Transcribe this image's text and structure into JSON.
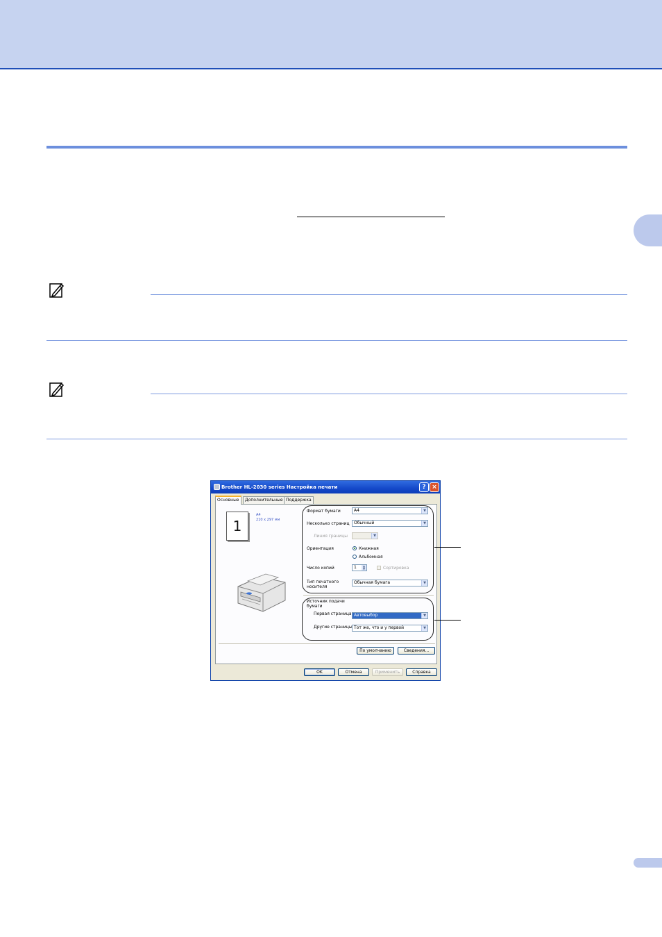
{
  "dialog": {
    "title": "Brother HL-2030 series Настройка печати",
    "help_glyph": "?",
    "close_glyph": "×",
    "tabs": [
      "Основные",
      "Дополнительные",
      "Поддержка"
    ],
    "preview": {
      "page_number": "1",
      "paper_name": "A4",
      "paper_size": "210 x 297 мм"
    },
    "paper_group": {
      "paper_size_label": "Формат бумаги",
      "paper_size_value": "A4",
      "multi_page_label": "Несколько страниц",
      "multi_page_value": "Обычный",
      "border_line_label": "Линия границы",
      "orientation_label": "Ориентация",
      "portrait_label": "Книжная",
      "landscape_label": "Альбомная",
      "copies_label": "Число копий",
      "copies_value": "1",
      "collate_label": "Сортировка",
      "media_type_label_1": "Тип печатного",
      "media_type_label_2": "носителя",
      "media_type_value": "Обычная бумага"
    },
    "source_group": {
      "source_label_1": "Источник подачи",
      "source_label_2": "бумаги",
      "first_page_label": "Первая страница",
      "first_page_value": "Автовыбор",
      "other_pages_label": "Другие страницы",
      "other_pages_value": "Тот же, что и у первой"
    },
    "buttons": {
      "default": "По умолчанию",
      "about": "Сведения...",
      "ok": "OK",
      "cancel": "Отмена",
      "apply": "Применить",
      "help": "Справка"
    }
  }
}
